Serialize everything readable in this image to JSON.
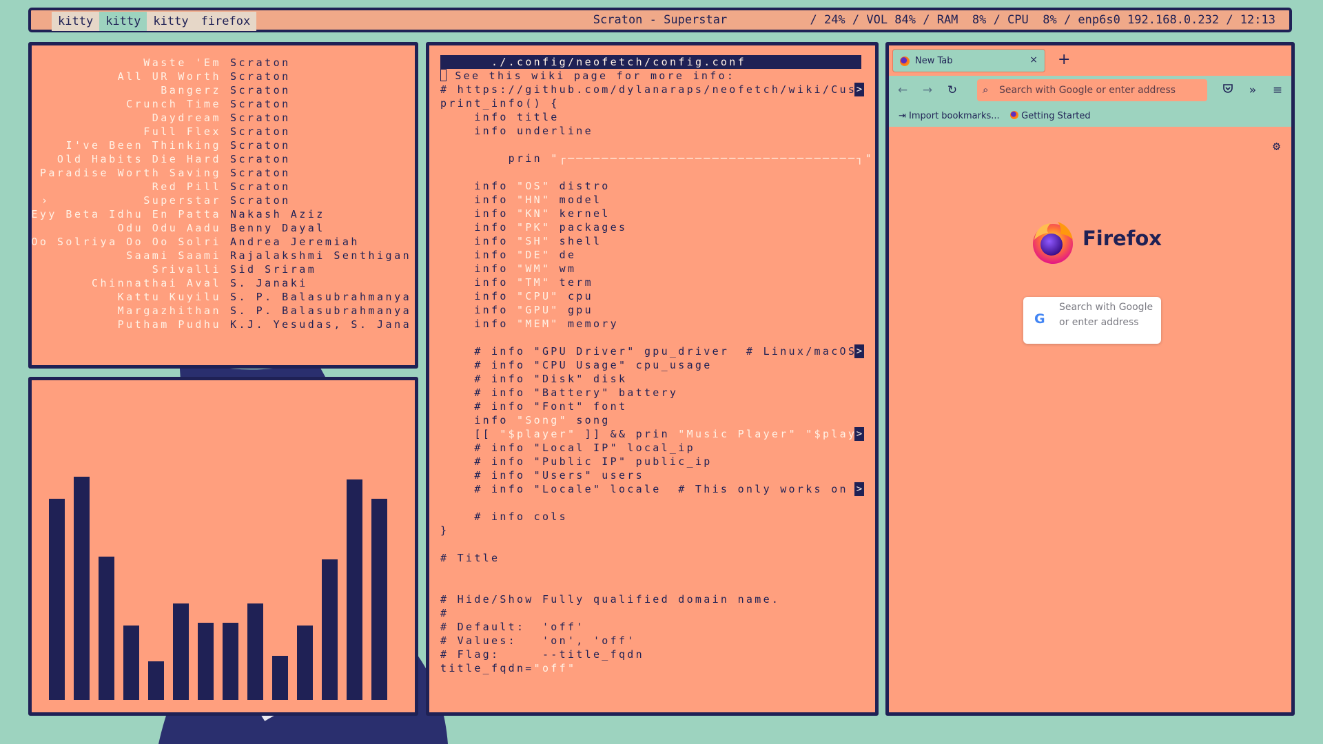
{
  "topbar": {
    "workspaces": [
      "kitty",
      "kitty",
      "kitty",
      "firefox"
    ],
    "active_workspace": 1,
    "title": "Scraton - Superstar",
    "status": "/ 24% / VOL 84% / RAM  8% / CPU  8% / enp6s0 192.168.0.232 / 12:13"
  },
  "playlist": {
    "current_marker": "›",
    "tracks": [
      {
        "title": "Waste 'Em",
        "artist": "Scraton"
      },
      {
        "title": "All UR Worth",
        "artist": "Scraton"
      },
      {
        "title": "Bangerz",
        "artist": "Scraton"
      },
      {
        "title": "Crunch Time",
        "artist": "Scraton"
      },
      {
        "title": "Daydream",
        "artist": "Scraton"
      },
      {
        "title": "Full Flex",
        "artist": "Scraton"
      },
      {
        "title": "I've Been Thinking",
        "artist": "Scraton"
      },
      {
        "title": "Old Habits Die Hard",
        "artist": "Scraton"
      },
      {
        "title": "Paradise Worth Saving",
        "artist": "Scraton"
      },
      {
        "title": "Red Pill",
        "artist": "Scraton"
      },
      {
        "title": "Superstar",
        "artist": "Scraton",
        "current": true
      },
      {
        "title": "Eyy Beta Idhu En Patta",
        "artist": "Nakash Aziz"
      },
      {
        "title": "Odu Odu Aadu",
        "artist": "Benny Dayal"
      },
      {
        "title": "Oo Solriya Oo Oo Solri",
        "artist": "Andrea Jeremiah"
      },
      {
        "title": "Saami Saami",
        "artist": "Rajalakshmi Senthigan"
      },
      {
        "title": "Srivalli",
        "artist": "Sid Sriram"
      },
      {
        "title": "Chinnathai Aval",
        "artist": "S. Janaki"
      },
      {
        "title": "Kattu Kuyilu",
        "artist": "S. P. Balasubrahmanya"
      },
      {
        "title": "Margazhithan",
        "artist": "S. P. Balasubrahmanya"
      },
      {
        "title": "Putham Pudhu",
        "artist": "K.J. Yesudas, S. Jana"
      }
    ]
  },
  "visualizer": {
    "levels": [
      0.73,
      0.81,
      0.52,
      0.27,
      0.14,
      0.35,
      0.28,
      0.28,
      0.35,
      0.16,
      0.27,
      0.51,
      0.8,
      0.73
    ]
  },
  "editor": {
    "filename": "./.config/neofetch/config.conf",
    "lines": [
      {
        "parts": [
          {
            "t": "# See this wiki page for more info:"
          }
        ],
        "cursor": true
      },
      {
        "parts": [
          {
            "t": "# https://github.com/dylanaraps/neofetch/wiki/Cust"
          }
        ],
        "trunc": true
      },
      {
        "parts": [
          {
            "t": "print_info() {"
          }
        ]
      },
      {
        "parts": [
          {
            "t": "    info title"
          }
        ]
      },
      {
        "parts": [
          {
            "t": "    info underline"
          }
        ]
      },
      {
        "parts": [
          {
            "t": ""
          }
        ]
      },
      {
        "parts": [
          {
            "t": "        prin "
          },
          {
            "t": "\"┌──────────────────────────────────┐\"",
            "s": true
          }
        ]
      },
      {
        "parts": [
          {
            "t": ""
          }
        ]
      },
      {
        "parts": [
          {
            "t": "    info "
          },
          {
            "t": "\"OS\"",
            "s": true
          },
          {
            "t": " distro"
          }
        ]
      },
      {
        "parts": [
          {
            "t": "    info "
          },
          {
            "t": "\"HN\"",
            "s": true
          },
          {
            "t": " model"
          }
        ]
      },
      {
        "parts": [
          {
            "t": "    info "
          },
          {
            "t": "\"KN\"",
            "s": true
          },
          {
            "t": " kernel"
          }
        ]
      },
      {
        "parts": [
          {
            "t": "    info "
          },
          {
            "t": "\"PK\"",
            "s": true
          },
          {
            "t": " packages"
          }
        ]
      },
      {
        "parts": [
          {
            "t": "    info "
          },
          {
            "t": "\"SH\"",
            "s": true
          },
          {
            "t": " shell"
          }
        ]
      },
      {
        "parts": [
          {
            "t": "    info "
          },
          {
            "t": "\"DE\"",
            "s": true
          },
          {
            "t": " de"
          }
        ]
      },
      {
        "parts": [
          {
            "t": "    info "
          },
          {
            "t": "\"WM\"",
            "s": true
          },
          {
            "t": " wm"
          }
        ]
      },
      {
        "parts": [
          {
            "t": "    info "
          },
          {
            "t": "\"TM\"",
            "s": true
          },
          {
            "t": " term"
          }
        ]
      },
      {
        "parts": [
          {
            "t": "    info "
          },
          {
            "t": "\"CPU\"",
            "s": true
          },
          {
            "t": " cpu"
          }
        ]
      },
      {
        "parts": [
          {
            "t": "    info "
          },
          {
            "t": "\"GPU\"",
            "s": true
          },
          {
            "t": " gpu"
          }
        ]
      },
      {
        "parts": [
          {
            "t": "    info "
          },
          {
            "t": "\"MEM\"",
            "s": true
          },
          {
            "t": " memory"
          }
        ]
      },
      {
        "parts": [
          {
            "t": ""
          }
        ]
      },
      {
        "parts": [
          {
            "t": "    # info \"GPU Driver\" gpu_driver  # Linux/macOS"
          }
        ],
        "trunc": true
      },
      {
        "parts": [
          {
            "t": "    # info \"CPU Usage\" cpu_usage"
          }
        ]
      },
      {
        "parts": [
          {
            "t": "    # info \"Disk\" disk"
          }
        ]
      },
      {
        "parts": [
          {
            "t": "    # info \"Battery\" battery"
          }
        ]
      },
      {
        "parts": [
          {
            "t": "    # info \"Font\" font"
          }
        ]
      },
      {
        "parts": [
          {
            "t": "    info "
          },
          {
            "t": "\"Song\"",
            "s": true
          },
          {
            "t": " song"
          }
        ]
      },
      {
        "parts": [
          {
            "t": "    [[ "
          },
          {
            "t": "\"$player\"",
            "s": true
          },
          {
            "t": " ]] && prin "
          },
          {
            "t": "\"Music Player\"",
            "s": true
          },
          {
            "t": " "
          },
          {
            "t": "\"$playe",
            "s": true
          }
        ],
        "trunc": true
      },
      {
        "parts": [
          {
            "t": "    # info \"Local IP\" local_ip"
          }
        ]
      },
      {
        "parts": [
          {
            "t": "    # info \"Public IP\" public_ip"
          }
        ]
      },
      {
        "parts": [
          {
            "t": "    # info \"Users\" users"
          }
        ]
      },
      {
        "parts": [
          {
            "t": "    # info \"Locale\" locale  # This only works on g"
          }
        ],
        "trunc": true
      },
      {
        "parts": [
          {
            "t": ""
          }
        ]
      },
      {
        "parts": [
          {
            "t": "    # info cols"
          }
        ]
      },
      {
        "parts": [
          {
            "t": "}"
          }
        ]
      },
      {
        "parts": [
          {
            "t": ""
          }
        ]
      },
      {
        "parts": [
          {
            "t": "# Title"
          }
        ]
      },
      {
        "parts": [
          {
            "t": ""
          }
        ]
      },
      {
        "parts": [
          {
            "t": ""
          }
        ]
      },
      {
        "parts": [
          {
            "t": "# Hide/Show Fully qualified domain name."
          }
        ]
      },
      {
        "parts": [
          {
            "t": "#"
          }
        ]
      },
      {
        "parts": [
          {
            "t": "# Default:  'off'"
          }
        ]
      },
      {
        "parts": [
          {
            "t": "# Values:   'on', 'off'"
          }
        ]
      },
      {
        "parts": [
          {
            "t": "# Flag:     --title_fqdn"
          }
        ]
      },
      {
        "parts": [
          {
            "t": "title_fqdn="
          },
          {
            "t": "\"off\"",
            "s": true
          }
        ]
      }
    ]
  },
  "browser": {
    "tab_label": "New Tab",
    "tab_close": "×",
    "new_tab": "+",
    "url_placeholder": "Search with Google or enter address",
    "bookmarks": [
      "Import bookmarks...",
      "Getting Started"
    ],
    "brand": "Firefox",
    "search_box_text": "Search with Google or enter address",
    "icons": [
      "back-icon",
      "forward-icon",
      "reload-icon",
      "search-icon",
      "pocket-icon",
      "overflow-icon",
      "menu-icon",
      "settings-gear-icon"
    ]
  },
  "colors": {
    "background": "#9dd3bf",
    "pane": "#ff9f7e",
    "border": "#1f2155",
    "highlight": "#fff2e6"
  }
}
